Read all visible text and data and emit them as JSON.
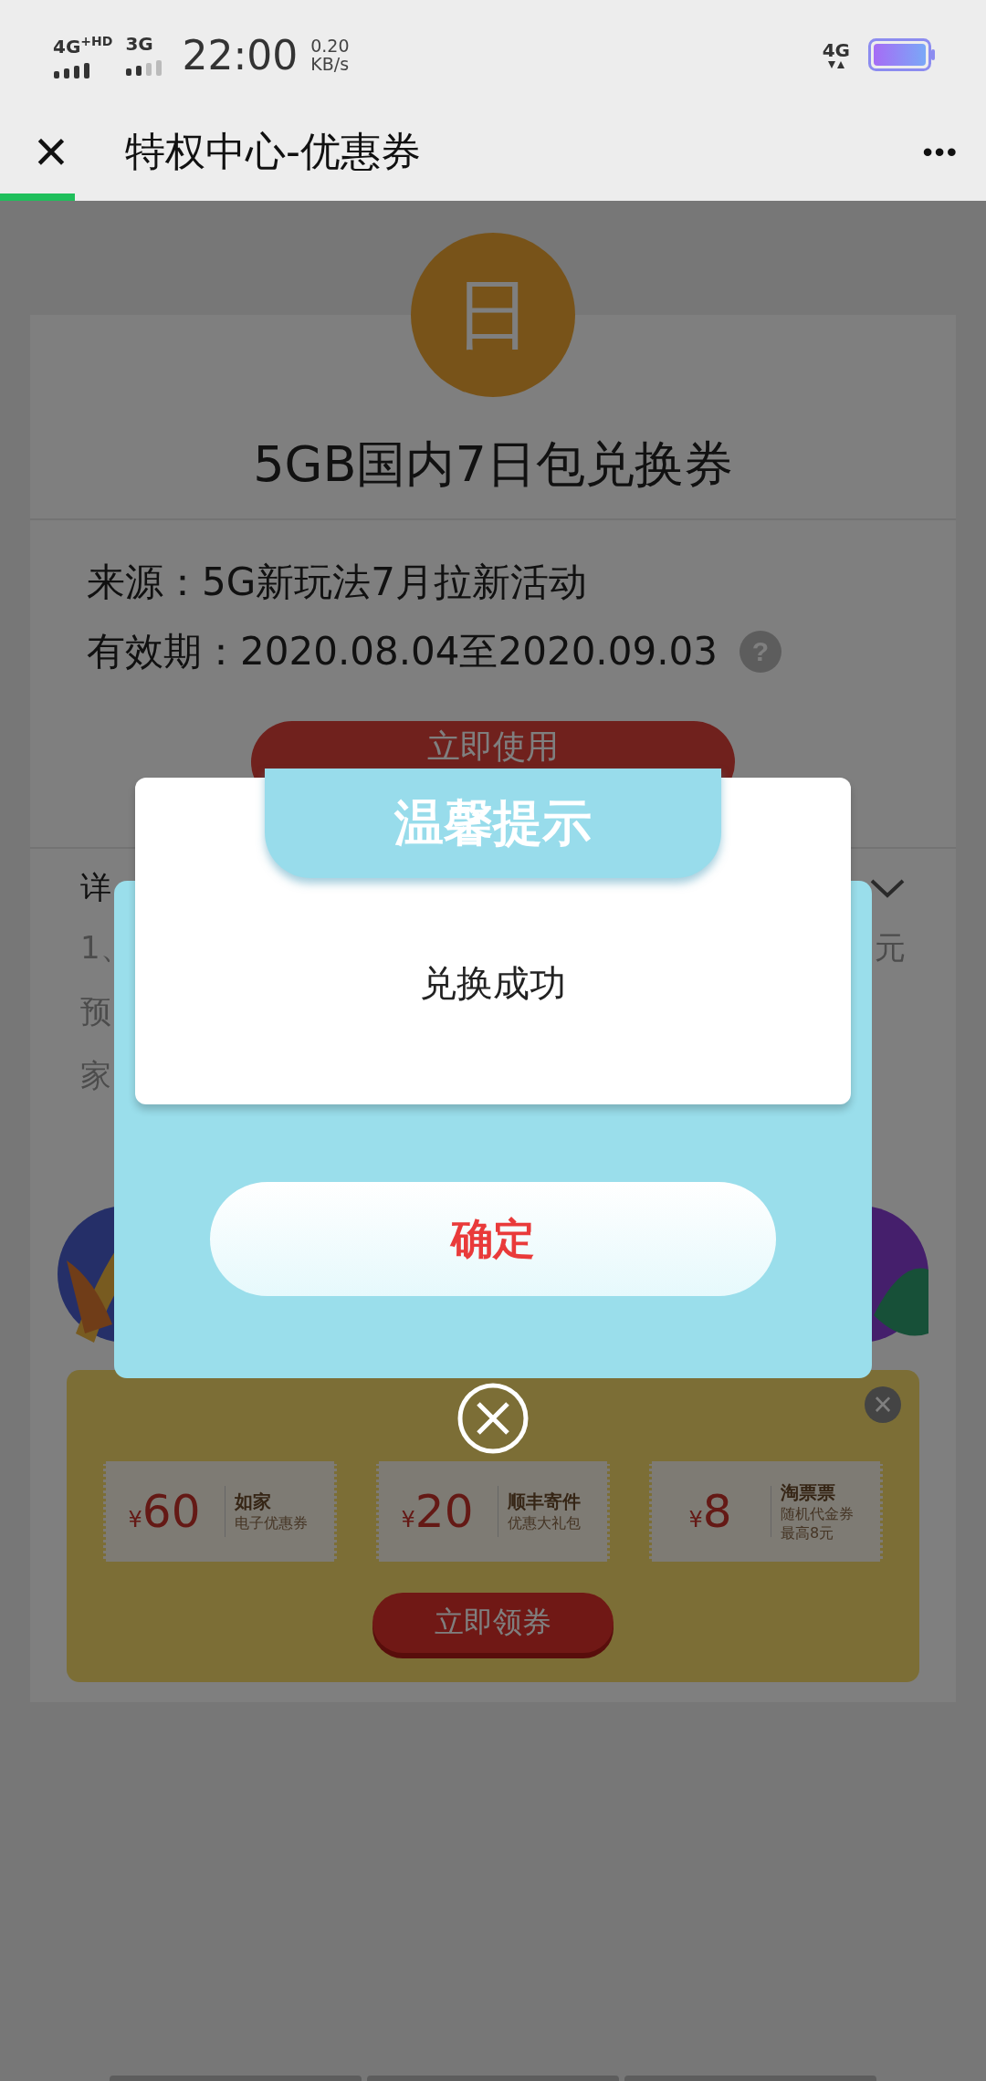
{
  "status_bar": {
    "network_1": "4G$^{+HD}$",
    "network_2": "3G",
    "time": "22:00",
    "speed": "0.20",
    "speed_unit": "KB/s",
    "network_right": "4G"
  },
  "nav_bar": {
    "close": "×",
    "title": "特权中心-优惠券",
    "more": "•••"
  },
  "page_progress": {
    "level": 0.076
  },
  "coupon": {
    "icon_glyph": "日",
    "title": "5GB国内7日包兑换券",
    "source": "来源：5G新玩法7月拉新活动",
    "validity": "有效期：2020.08.04至2020.09.03",
    "help": "?",
    "use_button": "立即使用",
    "details": {
      "title": "详",
      "lines": [
        {
          "start": "1、",
          "end": "元"
        },
        {
          "start": "预"
        },
        {
          "start": "家"
        }
      ]
    }
  },
  "promo": {
    "close": "×",
    "coupons": [
      {
        "currency": "¥",
        "amount": "60",
        "name": "如家",
        "desc": [
          "电子优惠券"
        ]
      },
      {
        "currency": "¥",
        "amount": "20",
        "name": "顺丰寄件",
        "desc": [
          "优惠大礼包"
        ]
      },
      {
        "currency": "¥",
        "amount": "8",
        "name": "淘票票",
        "desc": [
          "随机代金券",
          "最高8元"
        ]
      }
    ],
    "button": "立即领券"
  },
  "dialog": {
    "title": "温馨提示",
    "message": "兑换成功",
    "button": "确定"
  }
}
